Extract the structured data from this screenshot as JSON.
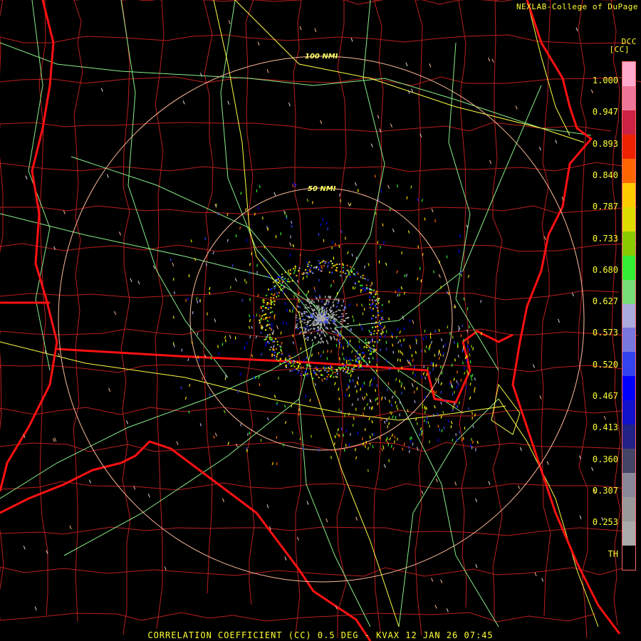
{
  "header": {
    "credit": "NEXLAB-College of DuPage",
    "product_code": "DCC",
    "unit": "[CC]"
  },
  "footer": {
    "title": "CORRELATION COEFFICIENT (CC) 0.5 DEG - KVAX 12 JAN 26 07:45"
  },
  "range_rings": [
    {
      "label": "50 NMI"
    },
    {
      "label": "100 NMI"
    }
  ],
  "legend": {
    "ticks": [
      "1.000",
      "0.947",
      "0.893",
      "0.840",
      "0.787",
      "0.733",
      "0.680",
      "0.627",
      "0.573",
      "0.520",
      "0.467",
      "0.413",
      "0.360",
      "0.307",
      "0.253",
      "TH"
    ],
    "colors": [
      "#ffaacc",
      "#ee7799",
      "#cc2244",
      "#ee2200",
      "#ff6600",
      "#ffcc00",
      "#dddd00",
      "#88cc00",
      "#33ee33",
      "#77dd77",
      "#aaaadd",
      "#7777dd",
      "#3344ee",
      "#0000ff",
      "#1111cc",
      "#222288",
      "#444466",
      "#888899",
      "#999999",
      "#aaaaaa",
      "#000000"
    ]
  },
  "map_colors": {
    "state_border": "#ff1111",
    "county_border": "#cc2222",
    "highway": "#ffff44",
    "road": "#88ee88",
    "range_ring": "#ffbb99",
    "background": "#000000"
  }
}
